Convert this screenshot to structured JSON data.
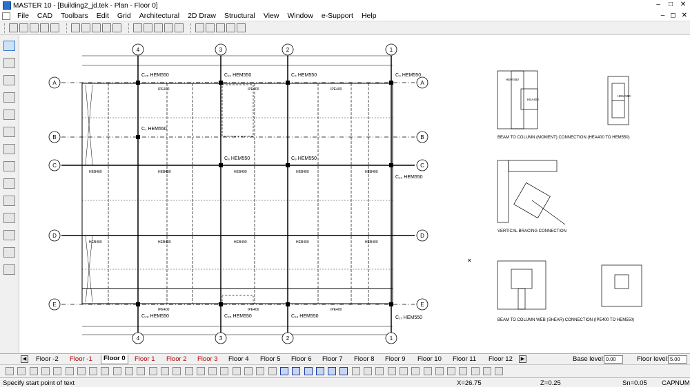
{
  "window": {
    "title": "MASTER 10 - [Building2_jd.tek - Plan - Floor 0]",
    "controls": [
      "–",
      "□",
      "✕"
    ]
  },
  "menu": {
    "items": [
      "File",
      "CAD",
      "Toolbars",
      "Edit",
      "Grid",
      "Architectural",
      "2D Draw",
      "Structural",
      "View",
      "Window",
      "e-Support",
      "Help"
    ],
    "controls": [
      "–",
      "◻",
      "✕"
    ]
  },
  "plan": {
    "grid_cols": [
      "4",
      "3",
      "2",
      "1"
    ],
    "grid_rows": [
      "A",
      "B",
      "C",
      "D",
      "E"
    ],
    "columns": [
      {
        "label": "C₂₅ HEM550"
      },
      {
        "label": "C₂₁ HEM550"
      },
      {
        "label": "C₄ HEM550"
      },
      {
        "label": "C₃ HEM550"
      },
      {
        "label": "C₇ HEM550"
      },
      {
        "label": "C₈ HEM550"
      },
      {
        "label": "C₉ HEM550"
      },
      {
        "label": "C₁₀ HEM550"
      },
      {
        "label": "C₂₈ HEM550"
      },
      {
        "label": "C₂₆ HEM550"
      },
      {
        "label": "C₁₈ HEM550"
      },
      {
        "label": "C₁₇ HEM550"
      }
    ],
    "beam_labels": [
      "HEB400",
      "IPE400",
      "IPE410",
      "HEA400",
      "IPE440"
    ]
  },
  "details": {
    "captions": [
      "BEAM TO COLUMN (MOMENT) CONNECTION (HEA400 TO HEM550)",
      "VERTICAL BRACING CONNECTION",
      "BEAM TO COLUMN WEB (SHEAR) CONNECTION (IPE400 TO HEM550)"
    ],
    "marks": [
      "HEM 550",
      "HEA400",
      "HEM 550"
    ]
  },
  "tabs": {
    "items": [
      {
        "label": "Floor -2",
        "color": "black"
      },
      {
        "label": "Floor -1",
        "color": "red"
      },
      {
        "label": "Floor 0",
        "color": "active"
      },
      {
        "label": "Floor 1",
        "color": "red"
      },
      {
        "label": "Floor 2",
        "color": "red"
      },
      {
        "label": "Floor 3",
        "color": "red"
      },
      {
        "label": "Floor 4",
        "color": "black"
      },
      {
        "label": "Floor 5",
        "color": "black"
      },
      {
        "label": "Floor 6",
        "color": "black"
      },
      {
        "label": "Floor 7",
        "color": "black"
      },
      {
        "label": "Floor 8",
        "color": "black"
      },
      {
        "label": "Floor 9",
        "color": "black"
      },
      {
        "label": "Floor 10",
        "color": "black"
      },
      {
        "label": "Floor 11",
        "color": "black"
      },
      {
        "label": "Floor 12",
        "color": "black"
      }
    ],
    "base_level_label": "Base level:",
    "base_level_value": "0.00",
    "floor_level_label": "Floor level:",
    "floor_level_value": "5.00"
  },
  "status": {
    "message": "Specify start point of text",
    "x": "X=26.75",
    "z": "Z=0.25",
    "sn": "Sn=0.05",
    "caps": "CAP",
    "num": "NUM"
  },
  "icons": {
    "top_toolbar": [
      "new-file-icon",
      "open-file-icon",
      "save-icon",
      "print-icon",
      "cut-icon",
      "copy-icon",
      "paste-icon",
      "undo-icon",
      "grid-icon",
      "line-icon",
      "circle-icon",
      "arc-icon",
      "text-icon",
      "dimension-icon",
      "hatch-icon",
      "tools-icon",
      "view-icon",
      "zoom-icon",
      "layer-icon",
      "pan-icon"
    ],
    "left_toolbar": [
      "select-object-icon",
      "beam-icon",
      "column-icon",
      "slab-icon",
      "wall-icon",
      "foundation-icon",
      "brace-icon",
      "erase-icon",
      "move-icon",
      "pencil-icon",
      "load-icon",
      "member-icon",
      "section-icon",
      "dropper-icon"
    ]
  }
}
